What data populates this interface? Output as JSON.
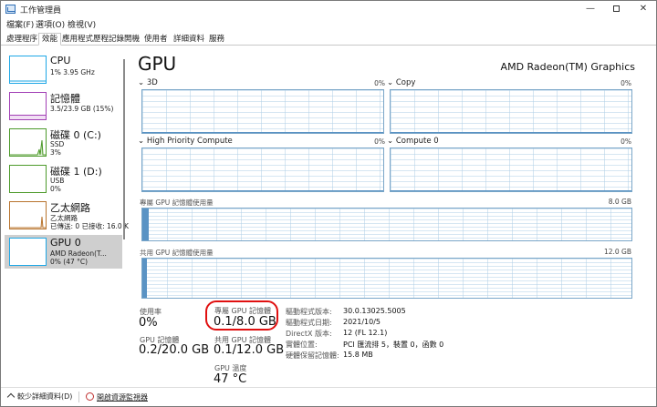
{
  "window": {
    "title": "工作管理員",
    "controls": {
      "minimize": "—",
      "close": "✕"
    }
  },
  "menu": [
    "檔案(F)",
    "選項(O)",
    "檢視(V)"
  ],
  "tabs": [
    {
      "label": "處理程序",
      "active": false
    },
    {
      "label": "效能",
      "active": true
    },
    {
      "label": "應用程式歷程記錄",
      "active": false
    },
    {
      "label": "開機",
      "active": false
    },
    {
      "label": "使用者",
      "active": false
    },
    {
      "label": "詳細資料",
      "active": false
    },
    {
      "label": "服務",
      "active": false
    }
  ],
  "sidebar": [
    {
      "title": "CPU",
      "lines": [
        "1% 3.95 GHz"
      ],
      "color": "#1ea7e6",
      "active": false
    },
    {
      "title": "記憶體",
      "lines": [
        "3.5/23.9 GB (15%)"
      ],
      "color": "#a23fb5",
      "active": false
    },
    {
      "title": "磁碟 0 (C:)",
      "lines": [
        "SSD",
        "3%"
      ],
      "color": "#4c9a2a",
      "active": false
    },
    {
      "title": "磁碟 1 (D:)",
      "lines": [
        "USB",
        "0%"
      ],
      "color": "#4c9a2a",
      "active": false
    },
    {
      "title": "乙太網路",
      "lines": [
        "乙太網路",
        "已傳送: 0 已接收: 16.0 K"
      ],
      "color": "#b8742e",
      "active": false
    },
    {
      "title": "GPU 0",
      "lines": [
        "AMD Radeon(T...",
        "0% (47 °C)"
      ],
      "color": "#1ea7e6",
      "active": true
    }
  ],
  "main": {
    "title": "GPU",
    "device": "AMD Radeon(TM) Graphics",
    "engines": [
      {
        "name": "3D",
        "percent": "0%"
      },
      {
        "name": "Copy",
        "percent": "0%"
      },
      {
        "name": "High Priority Compute",
        "percent": "0%"
      },
      {
        "name": "Compute 0",
        "percent": "0%"
      }
    ],
    "dedicated_memory": {
      "label": "專屬 GPU 記憶體使用量",
      "max": "8.0 GB",
      "used_fraction": 0.0125
    },
    "shared_memory": {
      "label": "共用 GPU 記憶體使用量",
      "max": "12.0 GB",
      "used_fraction": 0.0083
    },
    "stats": {
      "utilization_label": "使用率",
      "utilization": "0%",
      "dedicated_label": "專屬 GPU 記憶體",
      "dedicated": "0.1/8.0 GB",
      "gpu_memory_label": "GPU 記憶體",
      "gpu_memory": "0.2/20.0 GB",
      "shared_label": "共用 GPU 記憶體",
      "shared": "0.1/12.0 GB",
      "temp_label": "GPU 溫度",
      "temp": "47 °C"
    },
    "info": [
      {
        "key": "驅動程式版本:",
        "value": "30.0.13025.5005"
      },
      {
        "key": "驅動程式日期:",
        "value": "2021/10/5"
      },
      {
        "key": "DirectX 版本:",
        "value": "12 (FL 12.1)"
      },
      {
        "key": "實體位置:",
        "value": "PCI 匯流排 5，裝置 0，函數 0"
      },
      {
        "key": "硬體保留記憶體:",
        "value": "15.8 MB"
      }
    ]
  },
  "footer": {
    "fewer_details": "較少詳細資料(D)",
    "open_monitor": "開啟資源監視器"
  }
}
